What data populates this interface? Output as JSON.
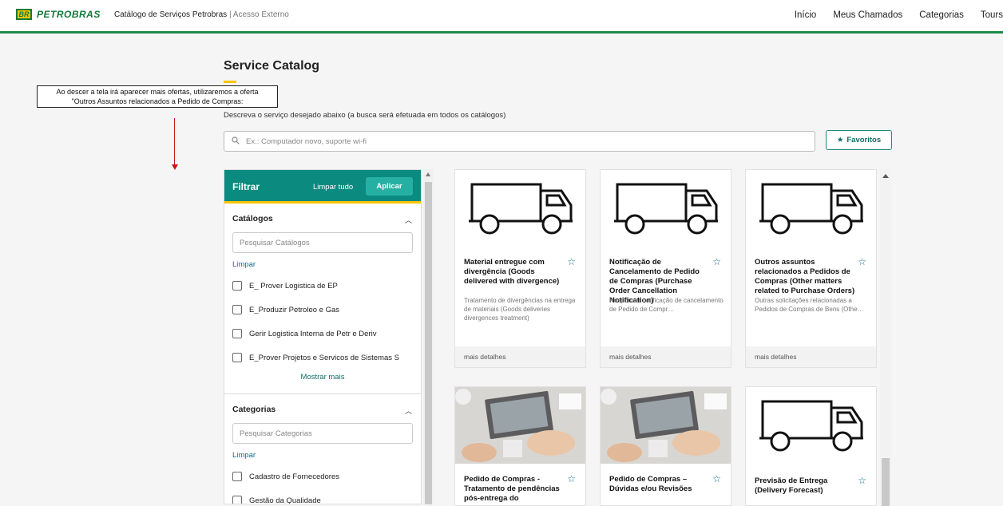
{
  "header": {
    "logo_badge": "BR",
    "logo_text": "PETROBRAS",
    "app_title": "Catálogo de Serviços Petrobras",
    "app_subtitle": "| Acesso Externo",
    "nav": [
      "Início",
      "Meus Chamados",
      "Categorias",
      "Tours"
    ]
  },
  "page": {
    "title": "Service Catalog",
    "description": "Descreva o serviço desejado abaixo (a busca será efetuada em todos os catálogos)",
    "search_placeholder": "Ex.: Computador novo, suporte wi-fi",
    "favorites_label": "Favoritos"
  },
  "annotation": {
    "line1": "Ao descer a tela irá aparecer mais ofertas, utilizaremos a oferta",
    "line2": "\"Outros Assuntos relacionados a Pedido de Compras:"
  },
  "filter": {
    "title": "Filtrar",
    "clear_all": "Limpar tudo",
    "apply": "Aplicar",
    "catalogs": {
      "title": "Catálogos",
      "search_placeholder": "Pesquisar Catálogos",
      "clear": "Limpar",
      "items": [
        "E_ Prover Logistica de EP",
        "E_Produzir Petroleo e Gas",
        "Gerir Logistica Interna de Petr e Deriv",
        "E_Prover Projetos e Servicos de Sistemas S"
      ],
      "show_more": "Mostrar mais"
    },
    "categories": {
      "title": "Categorias",
      "search_placeholder": "Pesquisar Categorias",
      "clear": "Limpar",
      "items": [
        "Cadastro de Fornecedores",
        "Gestão da Qualidade"
      ]
    }
  },
  "cards": [
    {
      "title": "Material entregue com divergência (Goods delivered with divergence)",
      "description": "Tratamento de divergências na entrega de materiais (Goods deliveries divergences treatment)",
      "footer": "mais detalhes",
      "image": "truck-icon"
    },
    {
      "title": "Notificação de Cancelamento de Pedido de Compras (Purchase Order Cancellation Notification)",
      "description": "Responder notificação de cancelamento de Pedido de Compr…",
      "footer": "mais detalhes",
      "image": "truck-icon"
    },
    {
      "title": "Outros assuntos relacionados a Pedidos de Compras (Other matters related to Purchase Orders)",
      "description": "Outras solicitações relacionadas a Pedidos de Compras de Bens (Othe…",
      "footer": "mais detalhes",
      "image": "truck-icon"
    },
    {
      "title": "Pedido de Compras - Tratamento de pendências pós-entrega do",
      "image": "desk-photo"
    },
    {
      "title": "Pedido de Compras – Dúvidas e/ou Revisões",
      "image": "desk-photo"
    },
    {
      "title": "Previsão de Entrega (Delivery Forecast)",
      "image": "truck-icon"
    }
  ],
  "colors": {
    "brand_green": "#1e8a4a",
    "filter_teal": "#0b8a7f",
    "accent_yellow": "#f7c500",
    "annotation_arrow": "#c0181b"
  }
}
